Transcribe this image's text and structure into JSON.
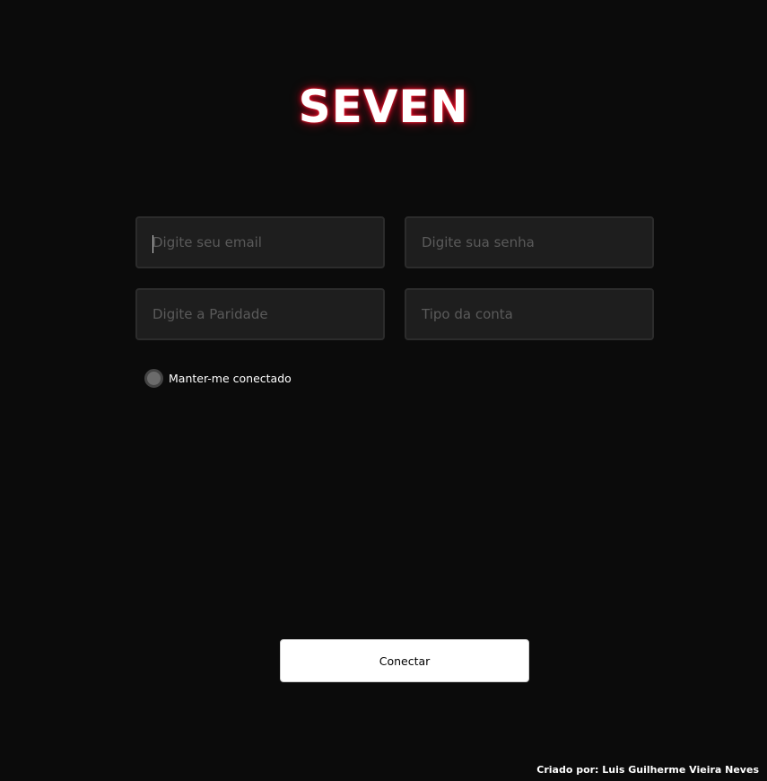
{
  "logo": {
    "text": "SEVEN",
    "glow_color": "#e0102a"
  },
  "form": {
    "email": {
      "value": "",
      "placeholder": "Digite seu email"
    },
    "senha": {
      "value": "",
      "placeholder": "Digite sua senha"
    },
    "paridade": {
      "value": "",
      "placeholder": "Digite a Paridade"
    },
    "tipo_conta": {
      "value": "",
      "placeholder": "Tipo da conta"
    }
  },
  "remember": {
    "label": "Manter-me conectado",
    "checked": false
  },
  "connect_button": {
    "label": "Conectar"
  },
  "footer": {
    "credit": "Criado por: Luis Guilherme Vieira Neves"
  },
  "colors": {
    "background": "#0b0b0b",
    "field_background": "#1e1e1e",
    "button_background": "#ffffff"
  }
}
